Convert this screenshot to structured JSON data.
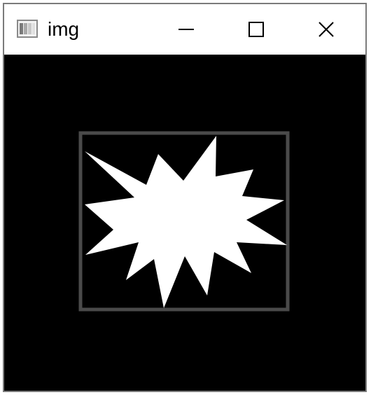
{
  "window": {
    "title": "img",
    "app_icon": "image-window-icon",
    "controls": {
      "minimize_icon": "minimize-icon",
      "maximize_icon": "maximize-icon",
      "close_icon": "close-icon"
    }
  },
  "canvas": {
    "background_color": "#000000",
    "frame_color": "#4a4a4a",
    "shape_color": "#ffffff",
    "shape": "starburst"
  }
}
